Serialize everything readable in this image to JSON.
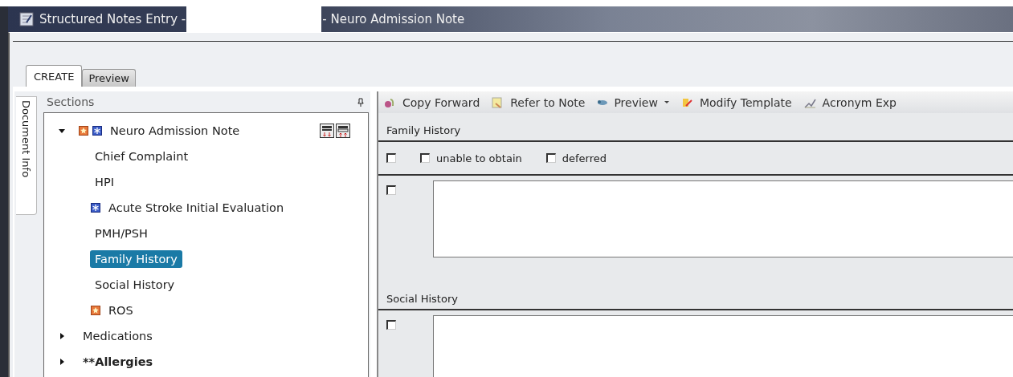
{
  "window": {
    "title_prefix": "Structured Notes Entry -",
    "title_suffix": "- Neuro Admission Note"
  },
  "tabs": [
    {
      "label": "CREATE",
      "selected": true
    },
    {
      "label": "Preview",
      "selected": false
    }
  ],
  "side_tab": {
    "label": "Document Info"
  },
  "sections_panel": {
    "title": "Sections",
    "items": [
      {
        "label": "Neuro Admission Note",
        "expanded": true,
        "selected": false,
        "star_icon": true,
        "asterisk_icon": true,
        "children": [
          {
            "label": "Chief Complaint",
            "selected": false
          },
          {
            "label": "HPI",
            "selected": false
          },
          {
            "label": "Acute Stroke Initial Evaluation",
            "selected": false,
            "asterisk_icon": true
          },
          {
            "label": "PMH/PSH",
            "selected": false
          },
          {
            "label": "Family History",
            "selected": true
          },
          {
            "label": "Social History",
            "selected": false
          },
          {
            "label": "ROS",
            "selected": false,
            "star_icon": true
          }
        ]
      },
      {
        "label": "Medications",
        "expanded": false,
        "selected": false
      },
      {
        "label": "**Allergies",
        "expanded": false,
        "selected": false,
        "bold": true
      }
    ]
  },
  "toolbar": [
    {
      "label": "Copy Forward",
      "kind": "copy"
    },
    {
      "label": "Refer to Note",
      "kind": "refer"
    },
    {
      "label": "Preview",
      "kind": "preview",
      "dropdown": true
    },
    {
      "label": "Modify Template",
      "kind": "modify"
    },
    {
      "label": "Acronym Exp",
      "kind": "acronym"
    }
  ],
  "note_sections": [
    {
      "title": "Family History",
      "rows": [
        {
          "kind": "options",
          "options": [
            {
              "checked": false
            },
            {
              "label": "unable to obtain",
              "checked": false
            },
            {
              "label": "deferred",
              "checked": false
            }
          ]
        },
        {
          "kind": "text",
          "checked": false
        }
      ]
    },
    {
      "title": "Social History",
      "rows": [
        {
          "kind": "text",
          "checked": false
        }
      ]
    }
  ]
}
